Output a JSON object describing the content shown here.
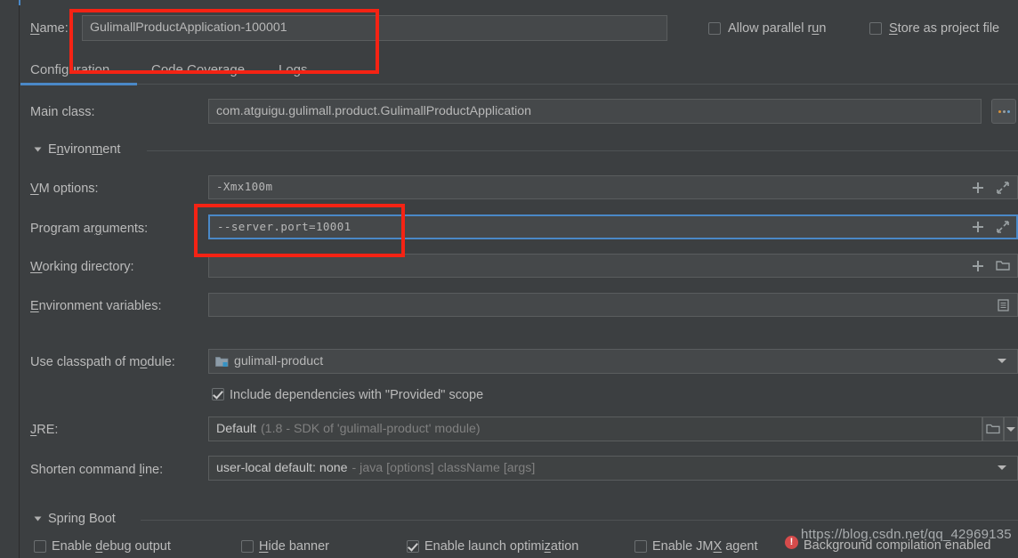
{
  "window": {
    "theme_bg": "#3c3f41",
    "field_bg": "#45484a",
    "accent": "#4a88c7",
    "annotation_color": "#f52314"
  },
  "header": {
    "name_label": "Name:",
    "name_label_mnemonic": "N",
    "name_value": "GulimallProductApplication-100001",
    "allow_parallel_run_label": "Allow parallel run",
    "allow_parallel_run_checked": false,
    "store_as_project_file_label": "Store as project file",
    "store_as_project_file_checked": false
  },
  "tabs": [
    {
      "label": "Configuration",
      "selected": true
    },
    {
      "label": "Code Coverage",
      "selected": false
    },
    {
      "label": "Logs",
      "selected": false
    }
  ],
  "main_class": {
    "label": "Main class:",
    "value": "com.atguigu.gulimall.product.GulimallProductApplication",
    "browse_button": "…"
  },
  "environment_section": {
    "title": "Environment",
    "expanded": true,
    "rows": [
      {
        "label": "VM options:",
        "mnemonic": "V",
        "value": "-Xmx100m",
        "placeholder": "",
        "focused": false,
        "actions": [
          "add-icon",
          "expand-icon"
        ]
      },
      {
        "label": "Program arguments:",
        "mnemonic": "g",
        "value": "--server.port=10001",
        "placeholder": "",
        "focused": true,
        "actions": [
          "add-icon",
          "expand-icon"
        ]
      },
      {
        "label": "Working directory:",
        "mnemonic": "W",
        "value": "",
        "placeholder": "",
        "focused": false,
        "actions": [
          "add-icon",
          "folder-icon"
        ]
      },
      {
        "label": "Environment variables:",
        "mnemonic": "E",
        "value": "",
        "placeholder": "",
        "focused": false,
        "actions": [
          "list-icon"
        ]
      }
    ]
  },
  "classpath": {
    "label": "Use classpath of module:",
    "mnemonic": "o",
    "value": "gulimall-product",
    "module_icon": "module-icon",
    "include_provided_label": "Include dependencies with \"Provided\" scope",
    "include_provided_checked": true
  },
  "jre": {
    "label": "JRE:",
    "mnemonic": "J",
    "value_strong": "Default",
    "value_dim": "(1.8 - SDK of 'gulimall-product' module)"
  },
  "shorten": {
    "label": "Shorten command line:",
    "mnemonic": "l",
    "value_strong": "user-local default: none",
    "value_dim": "- java [options] className [args]"
  },
  "spring_boot_section": {
    "title": "Spring Boot",
    "expanded": true,
    "checkboxes": [
      {
        "label": "Enable debug output",
        "mnemonic": "d",
        "checked": false
      },
      {
        "label": "Hide banner",
        "mnemonic": "H",
        "checked": false
      },
      {
        "label": "Enable launch optimization",
        "mnemonic": "z",
        "checked": true
      },
      {
        "label": "Enable JMX agent",
        "mnemonic": "X",
        "checked": false
      }
    ]
  },
  "status_bar": {
    "error_badge": "!",
    "message": "Background compilation enabled"
  },
  "watermark": {
    "text": "https://blog.csdn.net/qq_42969135"
  },
  "annotations": [
    {
      "name": "name-field-highlight"
    },
    {
      "name": "program-arguments-highlight"
    }
  ]
}
